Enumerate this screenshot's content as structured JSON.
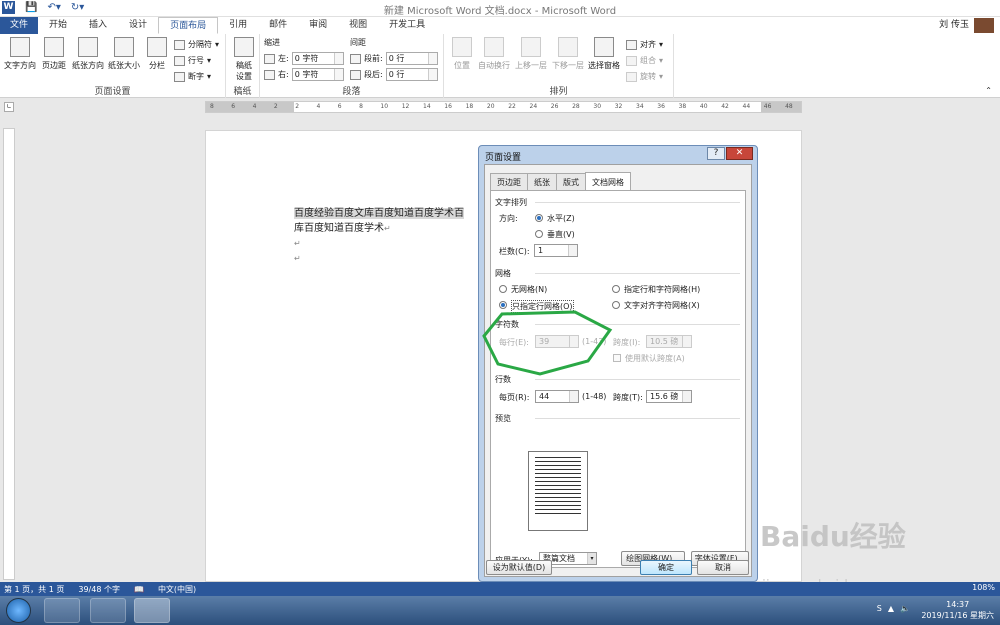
{
  "window": {
    "title": "新建 Microsoft Word 文档.docx - Microsoft Word",
    "user": "刘 传玉"
  },
  "tabs": [
    "开始",
    "插入",
    "设计",
    "页面布局",
    "引用",
    "邮件",
    "审阅",
    "视图",
    "开发工具"
  ],
  "file_tab": "文件",
  "ribbon": {
    "page_setup": {
      "label": "页面设置",
      "buttons": [
        "文字方向",
        "页边距",
        "纸张方向",
        "纸张大小",
        "分栏"
      ],
      "small": [
        "分隔符",
        "行号",
        "断字"
      ]
    },
    "draft": {
      "label": "稿纸",
      "button": "稿纸\n设置"
    },
    "paragraph": {
      "label": "段落",
      "indent": "缩进",
      "spacing": "间距",
      "left": "左:",
      "right": "右:",
      "before": "段前:",
      "after": "段后:",
      "left_val": "0 字符",
      "right_val": "0 字符",
      "before_val": "0 行",
      "after_val": "0 行"
    },
    "arrange": {
      "label": "排列",
      "buttons": [
        "位置",
        "自动换行",
        "上移一层",
        "下移一层",
        "选择窗格"
      ],
      "small": [
        "对齐",
        "组合",
        "旋转"
      ]
    }
  },
  "ruler": [
    "8",
    "6",
    "4",
    "2",
    "2",
    "4",
    "6",
    "8",
    "10",
    "12",
    "14",
    "16",
    "18",
    "20",
    "22",
    "24",
    "26",
    "28",
    "30",
    "32",
    "34",
    "36",
    "38",
    "40",
    "42",
    "44",
    "46",
    "48"
  ],
  "document": {
    "line1": "百度经验百度文库百度知道百度学术百",
    "line2": "库百度知道百度学术"
  },
  "status": {
    "page": "第 1 页，共 1 页",
    "words": "39/48 个字",
    "lang": "中文(中国)",
    "zoom": "108%"
  },
  "clock": {
    "time": "14:37",
    "date": "2019/11/16 星期六"
  },
  "dialog": {
    "title": "页面设置",
    "tabs": [
      "页边距",
      "纸张",
      "版式",
      "文档网格"
    ],
    "text_dir": {
      "label": "文字排列",
      "dir": "方向:",
      "h": "水平(Z)",
      "v": "垂直(V)",
      "cols": "栏数(C):",
      "cols_val": "1"
    },
    "grid": {
      "label": "网格",
      "none": "无网格(N)",
      "both": "指定行和字符网格(H)",
      "lines": "只指定行网格(O)",
      "snap": "文字对齐字符网格(X)"
    },
    "chars": {
      "label": "字符数",
      "per_line": "每行(E):",
      "val": "39",
      "range": "(1-43)",
      "pitch": "跨度(I):",
      "pitch_val": "10.5 磅",
      "default": "使用默认跨度(A)"
    },
    "lines": {
      "label": "行数",
      "per_page": "每页(R):",
      "val": "44",
      "range": "(1-48)",
      "pitch": "跨度(T):",
      "pitch_val": "15.6 磅"
    },
    "preview": "预览",
    "apply": {
      "label": "应用于(Y):",
      "val": "整篇文档"
    },
    "buttons": {
      "draw": "绘图网格(W)...",
      "font": "字体设置(F)...",
      "default": "设为默认值(D)",
      "ok": "确定",
      "cancel": "取消"
    }
  },
  "watermark": {
    "brand": "Baidu经验",
    "url": "jingyan.baidu.com"
  },
  "colors": {
    "accent": "#2b579a",
    "highlight": "#2aa845"
  }
}
